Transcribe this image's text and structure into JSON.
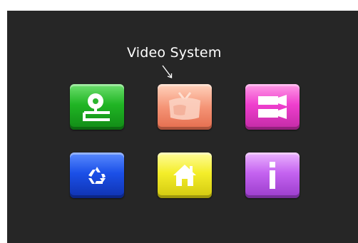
{
  "tooltip": {
    "label": "Video System"
  },
  "menu": {
    "items": [
      {
        "id": "disc",
        "icon": "disc-player-icon",
        "color": "#20b524"
      },
      {
        "id": "video-system",
        "icon": "tv-icon",
        "color": "#f59577",
        "selected": true
      },
      {
        "id": "video",
        "icon": "video-camera-icon",
        "color": "#ef3fce"
      },
      {
        "id": "recycle",
        "icon": "recycle-icon",
        "color": "#1b50e8"
      },
      {
        "id": "home",
        "icon": "home-icon",
        "color": "#f4ee2a"
      },
      {
        "id": "info",
        "icon": "info-icon",
        "color": "#c463f0"
      }
    ]
  }
}
